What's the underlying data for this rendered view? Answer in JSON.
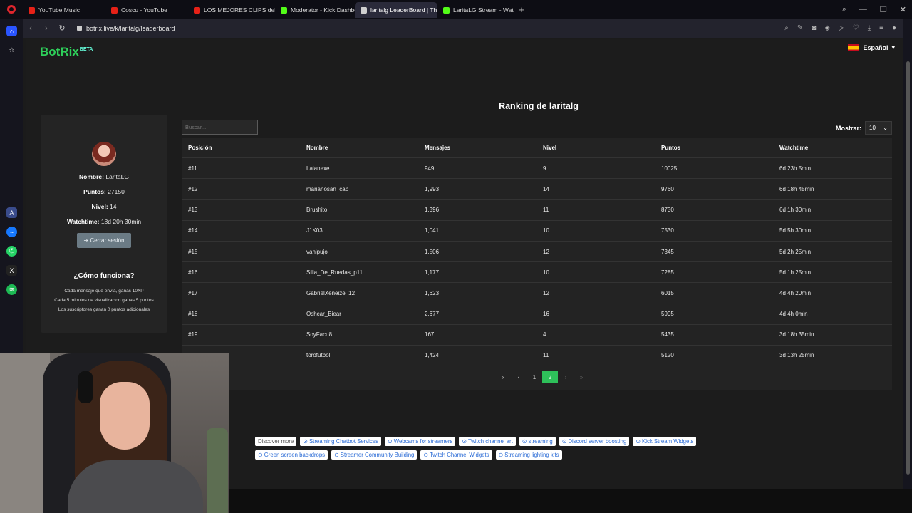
{
  "browser": {
    "tabs": [
      {
        "title": "YouTube Music",
        "color": "#e62117",
        "active": false
      },
      {
        "title": "Coscu - YouTube",
        "color": "#e62117",
        "active": false
      },
      {
        "title": "LOS MEJORES CLIPS del M",
        "color": "#e62117",
        "active": false
      },
      {
        "title": "Moderator - Kick Dashbo",
        "color": "#53fc18",
        "active": false
      },
      {
        "title": "laritalg LeaderBoard | The",
        "color": "#cfcfcf",
        "active": true
      },
      {
        "title": "LaritaLG Stream - Wat",
        "color": "#53fc18",
        "active": false
      }
    ],
    "url": "botrix.live/k/laritalg/leaderboard"
  },
  "site": {
    "brand": "BotRix",
    "brand_badge": "BETA",
    "language": "Español",
    "accent_color": "#2ed05a"
  },
  "page_title": "Ranking de laritalg",
  "profile": {
    "nombre_label": "Nombre:",
    "nombre": "LaritaLG",
    "puntos_label": "Puntos:",
    "puntos": "27150",
    "nivel_label": "Nivel:",
    "nivel": "14",
    "watchtime_label": "Watchtime:",
    "watchtime": "18d 20h 30min",
    "logout_label": "Cerrar sesión",
    "howto_title": "¿Cómo funciona?",
    "rules": [
      "Cada mensaje que envía, ganas 10XP",
      "Cada 5 minutos de visualizacion ganas 5 puntos",
      "Los suscriptores ganan 0 puntos adicionales"
    ]
  },
  "controls": {
    "search_placeholder": "Buscar...",
    "show_label": "Mostrar:",
    "show_value": "10"
  },
  "table": {
    "headers": [
      "Posición",
      "Nombre",
      "Mensajes",
      "Nivel",
      "Puntos",
      "Watchtime"
    ],
    "rows": [
      [
        "#11",
        "Lalanexe",
        "949",
        "9",
        "10025",
        "6d 23h 5min"
      ],
      [
        "#12",
        "marianosan_cab",
        "1,993",
        "14",
        "9760",
        "6d 18h 45min"
      ],
      [
        "#13",
        "Brushito",
        "1,396",
        "11",
        "8730",
        "6d 1h 30min"
      ],
      [
        "#14",
        "J1K03",
        "1,041",
        "10",
        "7530",
        "5d 5h 30min"
      ],
      [
        "#15",
        "vanipujol",
        "1,506",
        "12",
        "7345",
        "5d 2h 25min"
      ],
      [
        "#16",
        "Silla_De_Ruedas_p11",
        "1,177",
        "10",
        "7285",
        "5d 1h 25min"
      ],
      [
        "#17",
        "GabrielXeneize_12",
        "1,623",
        "12",
        "6015",
        "4d 4h 20min"
      ],
      [
        "#18",
        "Oshcar_Biear",
        "2,677",
        "16",
        "5995",
        "4d 4h 0min"
      ],
      [
        "#19",
        "SoyFacu8",
        "167",
        "4",
        "5435",
        "3d 18h 35min"
      ],
      [
        "",
        "torofutbol",
        "1,424",
        "11",
        "5120",
        "3d 13h 25min"
      ]
    ]
  },
  "pagination": {
    "first": "«",
    "prev": "‹",
    "pages": [
      "1",
      "2"
    ],
    "current": "2",
    "next": "›",
    "last": "»"
  },
  "discover": {
    "label": "Discover more",
    "tags": [
      "Streaming Chatbot Services",
      "Webcams for streamers",
      "Twitch channel art",
      "streaming",
      "Discord server boosting",
      "Kick Stream Widgets",
      "Green screen backdrops",
      "Streamer Community Building",
      "Twitch Channel Widgets",
      "Streaming lighting kits"
    ]
  }
}
